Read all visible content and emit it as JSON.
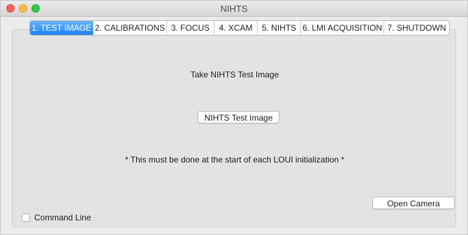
{
  "window": {
    "title": "NIHTS"
  },
  "tabs": [
    {
      "label": "1. TEST IMAGE",
      "active": true
    },
    {
      "label": "2. CALIBRATIONS",
      "active": false
    },
    {
      "label": "3. FOCUS",
      "active": false
    },
    {
      "label": "4. XCAM",
      "active": false
    },
    {
      "label": "5. NIHTS",
      "active": false
    },
    {
      "label": "6. LMI ACQUISITION",
      "active": false
    },
    {
      "label": "7. SHUTDOWN",
      "active": false
    }
  ],
  "main": {
    "heading": "Take NIHTS Test Image",
    "test_button_label": "NIHTS Test Image",
    "note": "* This must be done at the start of each LOUI initialization *",
    "open_camera_label": "Open Camera"
  },
  "footer": {
    "command_line_label": "Command Line",
    "command_line_checked": false
  },
  "colors": {
    "active_tab": "#1a82fb",
    "close": "#fc605c",
    "minimize": "#fdbc40",
    "maximize": "#34c84a"
  }
}
